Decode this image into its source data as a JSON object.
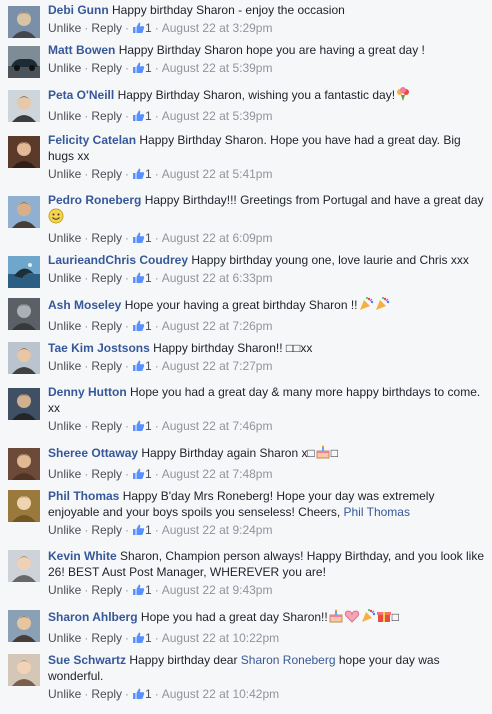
{
  "ui": {
    "unlike": "Unlike",
    "reply": "Reply",
    "sep": "·"
  },
  "colors": {
    "link": "#365899",
    "meta": "#90949c",
    "background": "#f6f7f9"
  },
  "comments": [
    {
      "author": "Debi Gunn",
      "text": "Happy birthday Sharon - enjoy the occasion",
      "likes": "1",
      "time": "August 22 at 3:29pm",
      "avatar": "avatar-photo"
    },
    {
      "author": "Matt Bowen",
      "text": "Happy Birthday Sharon hope you are having a great day !",
      "likes": "1",
      "time": "August 22 at 5:39pm",
      "avatar": "avatar-car"
    },
    {
      "author": "Peta O'Neill",
      "text": "Happy Birthday Sharon, wishing you a fantastic day!",
      "likes": "1",
      "time": "August 22 at 5:39pm",
      "avatar": "avatar-photo",
      "emoji": [
        "bouquet-emoji"
      ]
    },
    {
      "author": "Felicity Catelan",
      "text": "Happy Birthday Sharon. Hope you have had a great day. Big hugs xx",
      "likes": "1",
      "time": "August 22 at 5:41pm",
      "avatar": "avatar-photo"
    },
    {
      "author": "Pedro Roneberg",
      "text": "Happy Birthday!!! Greetings from Portugal and have a great day",
      "likes": "1",
      "time": "August 22 at 6:09pm",
      "avatar": "avatar-photo",
      "emoji": [
        "smile-emoji"
      ]
    },
    {
      "author": "LaurieandChris Coudrey",
      "text": "Happy birthday young one, love laurie and Chris xxx",
      "likes": "1",
      "time": "August 22 at 6:33pm",
      "avatar": "avatar-whale"
    },
    {
      "author": "Ash Moseley",
      "text": "Hope your having a great birthday Sharon !!",
      "likes": "1",
      "time": "August 22 at 7:26pm",
      "avatar": "avatar-photo",
      "emoji": [
        "party-popper-emoji",
        "party-popper-emoji"
      ]
    },
    {
      "author": "Tae Kim Jostsons",
      "text": "Happy birthday Sharon!! □□xx",
      "likes": "1",
      "time": "August 22 at 7:27pm",
      "avatar": "avatar-photo"
    },
    {
      "author": "Denny Hutton",
      "text": "Hope you had a great day & many more happy birthdays to come. xx",
      "likes": "1",
      "time": "August 22 at 7:46pm",
      "avatar": "avatar-photo"
    },
    {
      "author": "Sheree Ottaway",
      "text": "Happy Birthday again Sharon x□",
      "text2": "□",
      "likes": "1",
      "time": "August 22 at 7:48pm",
      "avatar": "avatar-photo",
      "emoji": [
        "cake-emoji"
      ]
    },
    {
      "author": "Phil Thomas",
      "text": "Happy B'day Mrs Roneberg! Hope your day was extremely enjoyable and your boys spoils you senseless! Cheers, ",
      "link": "Phil Thomas",
      "likes": "1",
      "time": "August 22 at 9:24pm",
      "avatar": "avatar-photo"
    },
    {
      "author": "Kevin White",
      "text": "Sharon, Champion person always! Happy Birthday, and you look like 26! BEST Aust Post Manager, WHEREVER you are!",
      "likes": "1",
      "time": "August 22 at 9:43pm",
      "avatar": "avatar-photo"
    },
    {
      "author": "Sharon Ahlberg",
      "text": "Hope you had a great day Sharon!!",
      "text2": "□",
      "likes": "1",
      "time": "August 22 at 10:22pm",
      "avatar": "avatar-photo",
      "emoji": [
        "cake-emoji",
        "heart-emoji",
        "party-popper-emoji",
        "gift-emoji"
      ]
    },
    {
      "author": "Sue Schwartz",
      "text": "Happy birthday dear ",
      "link": "Sharon Roneberg",
      "text_after": " hope your day was wonderful.",
      "likes": "1",
      "time": "August 22 at 10:42pm",
      "avatar": "avatar-photo"
    }
  ]
}
